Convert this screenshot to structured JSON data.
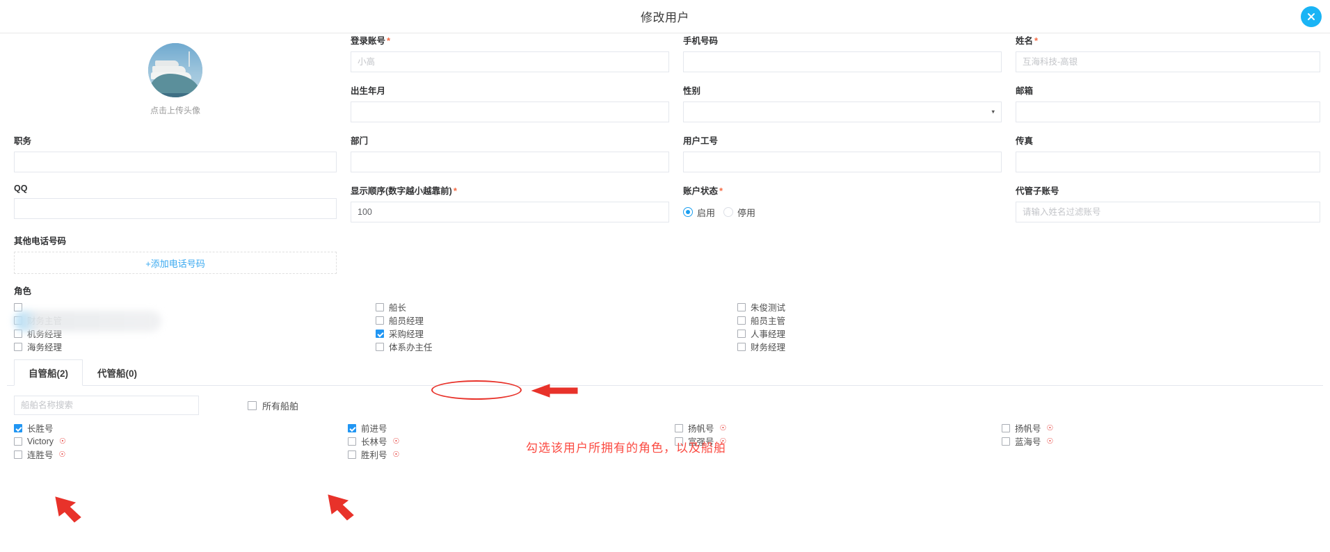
{
  "dialog": {
    "title": "修改用户",
    "close_icon": "close-circle-icon"
  },
  "avatar": {
    "caption": "点击上传头像",
    "icon": "ship-photo-avatar"
  },
  "form": {
    "login_account": {
      "label": "登录账号",
      "required": true,
      "placeholder": "小高",
      "value": ""
    },
    "mobile": {
      "label": "手机号码",
      "required": false,
      "placeholder": "",
      "value": ""
    },
    "name": {
      "label": "姓名",
      "required": true,
      "placeholder": "互海科技-高银",
      "value": ""
    },
    "birth": {
      "label": "出生年月",
      "required": false,
      "placeholder": "",
      "value": ""
    },
    "gender": {
      "label": "性别",
      "required": false,
      "placeholder": "",
      "value": "",
      "caret": "▾"
    },
    "email": {
      "label": "邮箱",
      "required": false,
      "placeholder": "",
      "value": ""
    },
    "position": {
      "label": "职务",
      "required": false,
      "placeholder": "",
      "value": ""
    },
    "department": {
      "label": "部门",
      "required": false,
      "placeholder": "",
      "value": ""
    },
    "employee_no": {
      "label": "用户工号",
      "required": false,
      "placeholder": "",
      "value": ""
    },
    "fax": {
      "label": "传真",
      "required": false,
      "placeholder": "",
      "value": ""
    },
    "qq": {
      "label": "QQ",
      "required": false,
      "placeholder": "",
      "value": ""
    },
    "display_order": {
      "label": "显示顺序(数字越小越靠前)",
      "required": true,
      "placeholder": "",
      "value": "100"
    },
    "account_status": {
      "label": "账户状态",
      "required": true,
      "options": [
        {
          "label": "启用",
          "selected": true
        },
        {
          "label": "停用",
          "selected": false
        }
      ]
    },
    "sub_account": {
      "label": "代管子账号",
      "required": false,
      "placeholder": "请输入姓名过滤账号",
      "value": ""
    },
    "other_phone": {
      "label": "其他电话号码",
      "add_label": "+添加电话号码"
    }
  },
  "roles": {
    "label": "角色",
    "columns": [
      [
        {
          "label": "",
          "checked": false,
          "obscured": true
        },
        {
          "label": "财务主管",
          "checked": false,
          "obscured": true
        },
        {
          "label": "机务经理",
          "checked": false
        },
        {
          "label": "海务经理",
          "checked": false
        }
      ],
      [
        {
          "label": "船长",
          "checked": false
        },
        {
          "label": "船员经理",
          "checked": false
        },
        {
          "label": "采购经理",
          "checked": true,
          "highlighted": true
        },
        {
          "label": "体系办主任",
          "checked": false
        }
      ],
      [
        {
          "label": "朱俊测试",
          "checked": false
        },
        {
          "label": "船员主管",
          "checked": false
        },
        {
          "label": "人事经理",
          "checked": false
        },
        {
          "label": "财务经理",
          "checked": false
        }
      ]
    ]
  },
  "annotation": {
    "note": "勾选该用户所拥有的角色，以及船舶",
    "color": "#fb4a41"
  },
  "ships": {
    "tabs": [
      {
        "label": "自管船(2)",
        "active": true
      },
      {
        "label": "代管船(0)",
        "active": false
      }
    ],
    "search_placeholder": "船舶名称搜索",
    "search_value": "",
    "all_ships_label": "所有船舶",
    "all_ships_checked": false,
    "warn_icon": "warning-circle-icon",
    "columns": [
      [
        {
          "label": "长胜号",
          "checked": true,
          "warn": false
        },
        {
          "label": "Victory",
          "checked": false,
          "warn": true
        },
        {
          "label": "连胜号",
          "checked": false,
          "warn": true
        }
      ],
      [
        {
          "label": "前进号",
          "checked": true,
          "warn": false
        },
        {
          "label": "长林号",
          "checked": false,
          "warn": true
        },
        {
          "label": "胜利号",
          "checked": false,
          "warn": true
        }
      ],
      [
        {
          "label": "扬帆号",
          "checked": false,
          "warn": true
        },
        {
          "label": "富强号",
          "checked": false,
          "warn": true
        }
      ],
      [
        {
          "label": "扬帆号",
          "checked": false,
          "warn": true
        },
        {
          "label": "蓝海号",
          "checked": false,
          "warn": true
        }
      ]
    ]
  },
  "colors": {
    "accent": "#1ab4f5",
    "required": "#f56c46",
    "annotation": "#fb4a41",
    "checkbox_on": "#2196f3",
    "warn": "#e53935"
  }
}
